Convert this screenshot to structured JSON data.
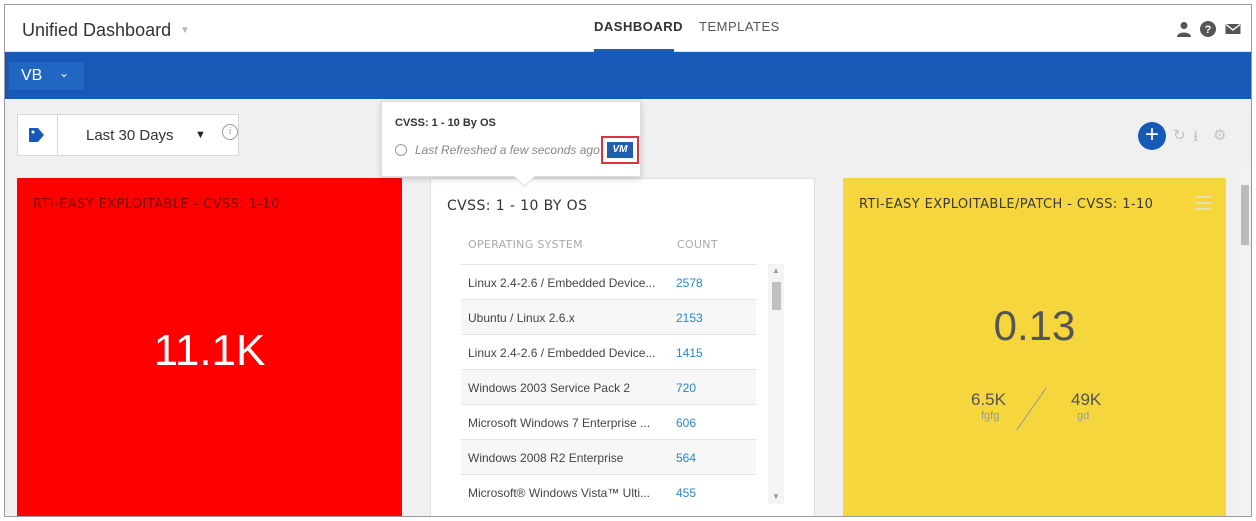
{
  "header": {
    "app_title": "Unified Dashboard",
    "tabs": [
      {
        "label": "DASHBOARD",
        "active": true
      },
      {
        "label": "TEMPLATES",
        "active": false
      }
    ],
    "icons": [
      "user-icon",
      "help-icon",
      "mail-icon"
    ]
  },
  "bluebar": {
    "selector_label": "VB"
  },
  "filter": {
    "range_label": "Last 30 Days",
    "info_glyph": "i"
  },
  "tooltip": {
    "title": "CVSS: 1 - 10 By OS",
    "refresh_text": "Last Refreshed a few seconds ago",
    "badge": "VM"
  },
  "widgets": {
    "red": {
      "title": "RTI-EASY EXPLOITABLE - CVSS: 1-10",
      "value": "11.1K",
      "color": "#ff0000"
    },
    "table": {
      "title": "CVSS: 1 - 10 BY OS",
      "columns": [
        "OPERATING SYSTEM",
        "COUNT"
      ],
      "rows": [
        {
          "os": "Linux 2.4-2.6 / Embedded Device...",
          "count": "2578"
        },
        {
          "os": "Ubuntu / Linux 2.6.x",
          "count": "2153"
        },
        {
          "os": "Linux 2.4-2.6 / Embedded Device...",
          "count": "1415"
        },
        {
          "os": "Windows 2003 Service Pack 2",
          "count": "720"
        },
        {
          "os": "Microsoft Windows 7 Enterprise ...",
          "count": "606"
        },
        {
          "os": "Windows 2008 R2 Enterprise",
          "count": "564"
        },
        {
          "os": "Microsoft® Windows Vista™ Ulti...",
          "count": "455"
        }
      ]
    },
    "yellow": {
      "title": "RTI-EASY EXPLOITABLE/PATCH - CVSS: 1-10",
      "value": "0.13",
      "numerator": "6.5K",
      "numerator_label": "fgfg",
      "denominator": "49K",
      "denominator_label": "gd",
      "color": "#f5d63d"
    }
  },
  "colors": {
    "primary": "#1759b7",
    "link": "#2b86c8",
    "highlight": "#d8363a"
  }
}
